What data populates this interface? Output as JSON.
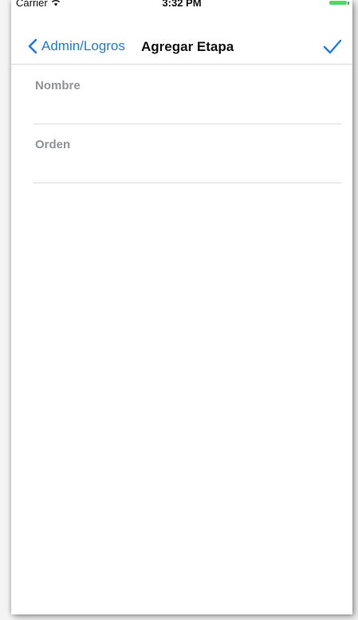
{
  "status_bar": {
    "carrier": "Carrier",
    "time": "3:32 PM"
  },
  "nav": {
    "back_label": "Admin/Logros",
    "title": "Agregar Etapa",
    "done_icon": "checkmark-icon",
    "back_icon": "chevron-left-icon"
  },
  "form": {
    "fields": [
      {
        "label": "Nombre",
        "value": "",
        "placeholder": ""
      },
      {
        "label": "Orden",
        "value": "",
        "placeholder": ""
      }
    ]
  },
  "colors": {
    "accent": "#1e7ce6",
    "label": "#8e949a",
    "separator": "#dcdcdc",
    "battery": "#4cd964"
  }
}
